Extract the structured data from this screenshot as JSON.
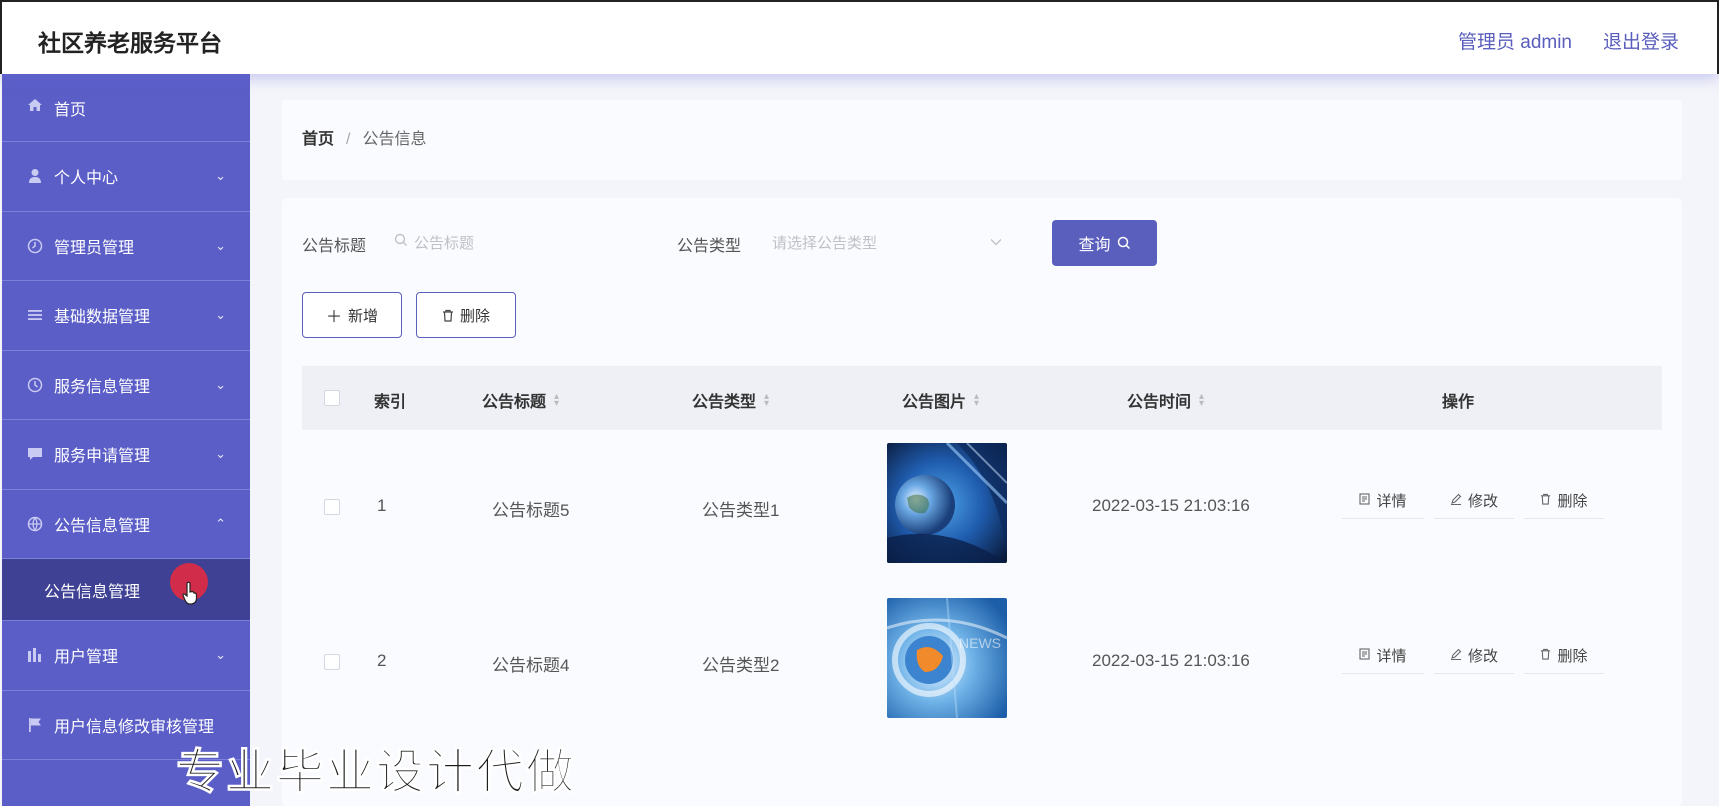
{
  "header": {
    "title": "社区养老服务平台",
    "user": "管理员 admin",
    "logout": "退出登录"
  },
  "sidebar": {
    "items": [
      {
        "label": "首页",
        "icon": "home-icon"
      },
      {
        "label": "个人中心",
        "icon": "user-icon"
      },
      {
        "label": "管理员管理",
        "icon": "clock-icon"
      },
      {
        "label": "基础数据管理",
        "icon": "list-icon"
      },
      {
        "label": "服务信息管理",
        "icon": "clock-icon"
      },
      {
        "label": "服务申请管理",
        "icon": "chat-icon"
      },
      {
        "label": "公告信息管理",
        "icon": "globe-icon"
      },
      {
        "label": "用户管理",
        "icon": "chart-icon"
      },
      {
        "label": "用户信息修改审核管理",
        "icon": "flag-icon"
      }
    ],
    "submenu_label": "公告信息管理"
  },
  "breadcrumb": {
    "home": "首页",
    "separator": "/",
    "current": "公告信息"
  },
  "search": {
    "title_label": "公告标题",
    "title_placeholder": "公告标题",
    "type_label": "公告类型",
    "type_placeholder": "请选择公告类型",
    "button": "查询"
  },
  "actions": {
    "add": "新增",
    "delete": "删除"
  },
  "table": {
    "columns": [
      "索引",
      "公告标题",
      "公告类型",
      "公告图片",
      "公告时间",
      "操作"
    ],
    "rows": [
      {
        "index": "1",
        "title": "公告标题5",
        "type": "公告类型1",
        "time": "2022-03-15 21:03:16"
      },
      {
        "index": "2",
        "title": "公告标题4",
        "type": "公告类型2",
        "time": "2022-03-15 21:03:16"
      }
    ],
    "ops": {
      "detail": "详情",
      "edit": "修改",
      "delete": "删除"
    }
  },
  "watermark": "专业毕业设计代做",
  "colors": {
    "sidebar": "#5b5ec7",
    "accent": "#5a5ebc",
    "submenu": "#3f4294"
  }
}
